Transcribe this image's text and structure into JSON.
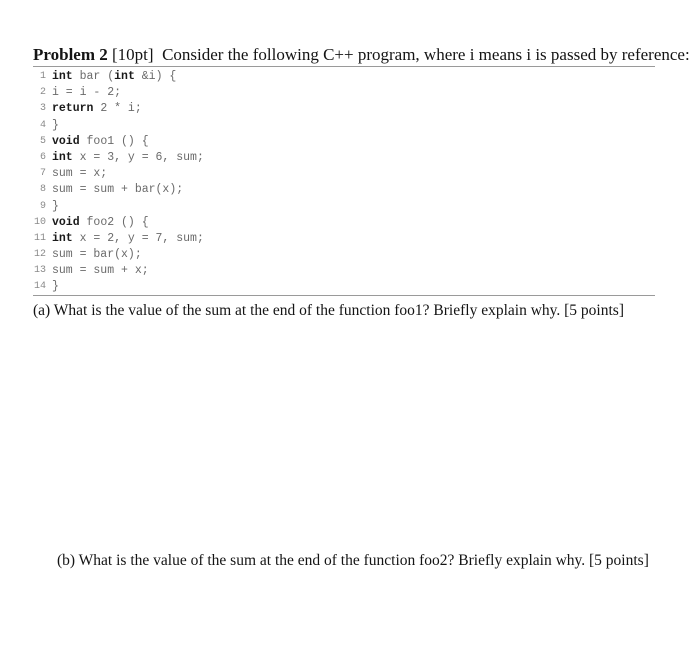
{
  "problem": {
    "label": "Problem 2",
    "points": "[10pt]",
    "prompt": "Consider the following C++ program, where i means i is passed by reference:"
  },
  "code": [
    {
      "num": "1",
      "tokens": [
        {
          "t": "int",
          "kw": true
        },
        {
          "t": " bar (",
          "kw": false
        },
        {
          "t": "int",
          "kw": true
        },
        {
          "t": " &i) {",
          "kw": false
        }
      ]
    },
    {
      "num": "2",
      "tokens": [
        {
          "t": "i = i - 2;",
          "kw": false
        }
      ]
    },
    {
      "num": "3",
      "tokens": [
        {
          "t": "return",
          "kw": true
        },
        {
          "t": " 2 * i;",
          "kw": false
        }
      ]
    },
    {
      "num": "4",
      "tokens": [
        {
          "t": "}",
          "kw": false
        }
      ]
    },
    {
      "num": "5",
      "tokens": [
        {
          "t": "void",
          "kw": true
        },
        {
          "t": " foo1 () {",
          "kw": false
        }
      ]
    },
    {
      "num": "6",
      "tokens": [
        {
          "t": "int",
          "kw": true
        },
        {
          "t": " x = 3, y = 6, sum;",
          "kw": false
        }
      ]
    },
    {
      "num": "7",
      "tokens": [
        {
          "t": "sum = x;",
          "kw": false
        }
      ]
    },
    {
      "num": "8",
      "tokens": [
        {
          "t": "sum = sum + bar(x);",
          "kw": false
        }
      ]
    },
    {
      "num": "9",
      "tokens": [
        {
          "t": "}",
          "kw": false
        }
      ]
    },
    {
      "num": "10",
      "tokens": [
        {
          "t": "void",
          "kw": true
        },
        {
          "t": " foo2 () {",
          "kw": false
        }
      ]
    },
    {
      "num": "11",
      "tokens": [
        {
          "t": "int",
          "kw": true
        },
        {
          "t": " x = 2, y = 7, sum;",
          "kw": false
        }
      ]
    },
    {
      "num": "12",
      "tokens": [
        {
          "t": "sum = bar(x);",
          "kw": false
        }
      ]
    },
    {
      "num": "13",
      "tokens": [
        {
          "t": "sum = sum + x;",
          "kw": false
        }
      ]
    },
    {
      "num": "14",
      "tokens": [
        {
          "t": "}",
          "kw": false
        }
      ]
    }
  ],
  "questions": {
    "a": "(a) What is the value of the sum at the end of the function foo1? Briefly explain why. [5 points]",
    "b": "(b) What is the value of the sum at the end of the function foo2? Briefly explain why. [5 points]"
  }
}
